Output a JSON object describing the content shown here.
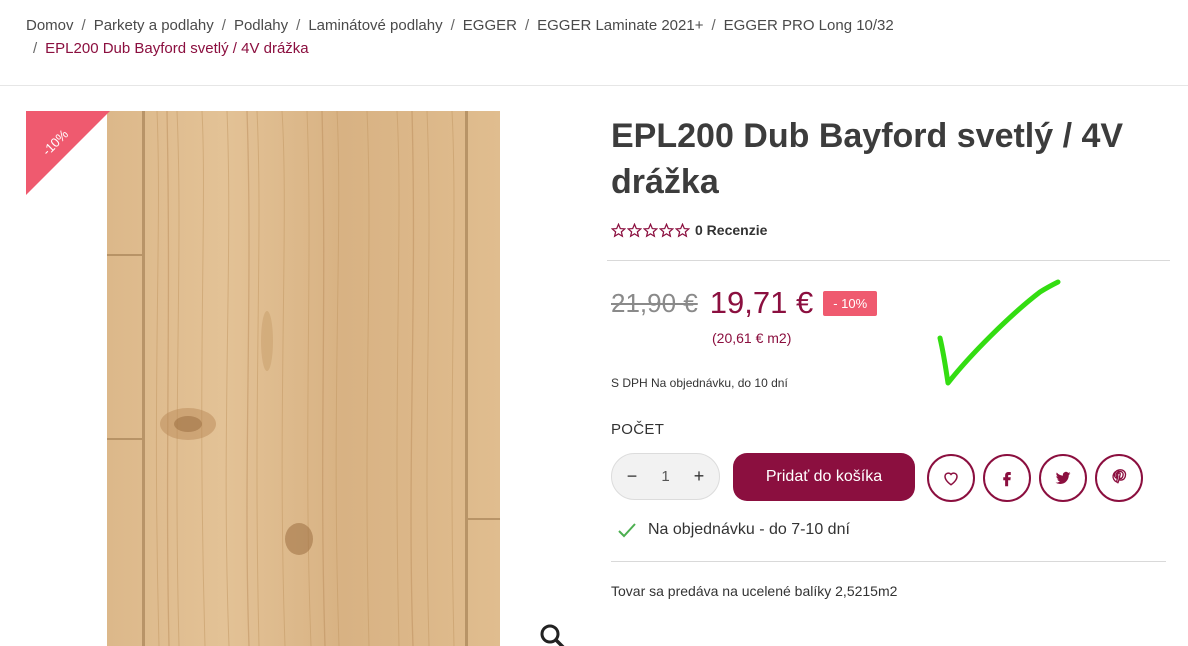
{
  "breadcrumb": {
    "items": [
      "Domov",
      "Parkety a podlahy",
      "Podlahy",
      "Laminátové podlahy",
      "EGGER",
      "EGGER Laminate 2021+",
      "EGGER PRO Long 10/32"
    ],
    "current": "EPL200 Dub Bayford svetlý / 4V drážka",
    "separator": "/"
  },
  "gallery": {
    "ribbon_label": "-10%",
    "zoom_icon": "magnifier-icon"
  },
  "product": {
    "title": "EPL200 Dub Bayford svetlý / 4V drážka",
    "rating_stars": 0,
    "reviews_label": "0 Recenzie",
    "old_price": "21,90 €",
    "new_price": "19,71 €",
    "discount_badge": "- 10%",
    "unit_price": "(20,61 € m2)",
    "tax_note": "S DPH Na objednávku, do 10 dní",
    "quantity_label": "POČET",
    "quantity_value": "1",
    "qty_minus": "−",
    "qty_plus": "+",
    "add_to_cart_label": "Pridať do košíka",
    "availability": "Na objednávku - do 7-10 dní",
    "package_note": "Tovar sa predáva na ucelené balíky 2,5215m2"
  },
  "icons": {
    "wishlist": "heart-icon",
    "facebook": "facebook-icon",
    "twitter": "twitter-icon",
    "pinterest": "pinterest-icon",
    "check": "check-icon"
  },
  "colors": {
    "brand": "#8b0f3f",
    "discount": "#ef5a6f",
    "availability_check": "#4caf50",
    "annotation": "#33dd11"
  }
}
